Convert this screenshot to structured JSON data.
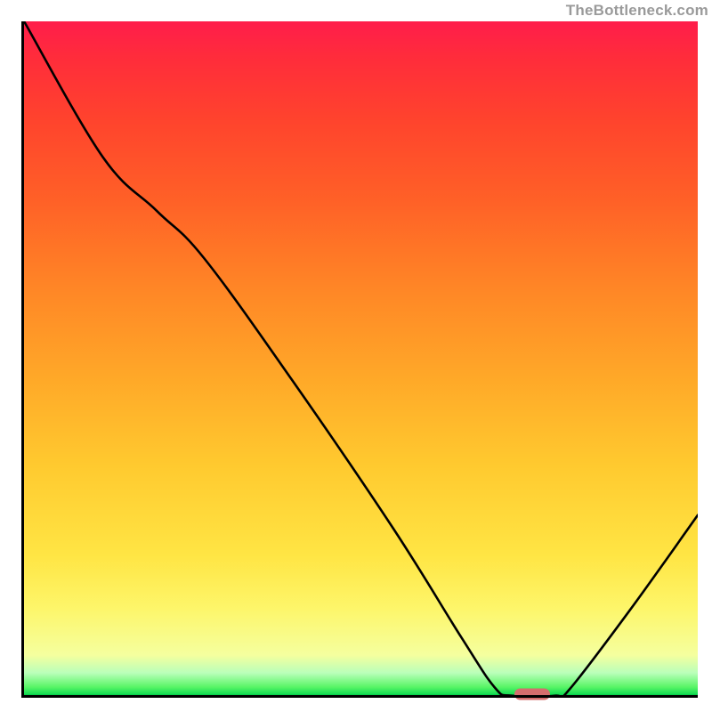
{
  "watermark": "TheBottleneck.com",
  "colors": {
    "curve_stroke": "#000000",
    "marker_fill": "#d46e6e",
    "axis_color": "#000000"
  },
  "chart_data": {
    "type": "line",
    "title": "",
    "xlabel": "",
    "ylabel": "",
    "xlim": [
      0,
      100
    ],
    "ylim": [
      0,
      100
    ],
    "curve": [
      {
        "x": 0.4,
        "y": 100.0
      },
      {
        "x": 12.0,
        "y": 80.0
      },
      {
        "x": 20.0,
        "y": 72.0
      },
      {
        "x": 27.0,
        "y": 65.0
      },
      {
        "x": 40.0,
        "y": 47.0
      },
      {
        "x": 55.0,
        "y": 25.0
      },
      {
        "x": 65.0,
        "y": 9.0
      },
      {
        "x": 70.0,
        "y": 1.5
      },
      {
        "x": 72.5,
        "y": 0.3
      },
      {
        "x": 79.0,
        "y": 0.3
      },
      {
        "x": 81.0,
        "y": 1.2
      },
      {
        "x": 90.0,
        "y": 13.0
      },
      {
        "x": 100.0,
        "y": 27.0
      }
    ],
    "marker": {
      "x": 75.5,
      "y": 0.5
    },
    "notes": "Background is a vertical gradient green→yellow→orange→red from bottom to top."
  }
}
